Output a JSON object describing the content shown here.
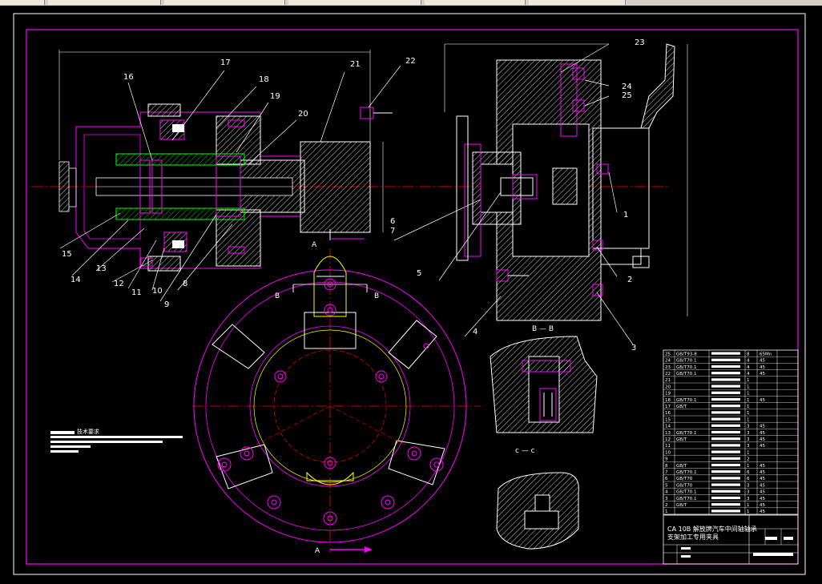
{
  "balloons": {
    "n16": "16",
    "n17": "17",
    "n18": "18",
    "n19": "19",
    "n20": "20",
    "n21": "21",
    "n22": "22",
    "n6": "6",
    "n7": "7",
    "n15": "15",
    "n14": "14",
    "n13": "13",
    "n12": "12",
    "n11": "11",
    "n10": "10",
    "n9": "9",
    "n8": "8",
    "n5": "5",
    "n23": "23",
    "n24": "24",
    "n25": "25",
    "n1": "1",
    "n2": "2",
    "n3": "3",
    "n4": "4"
  },
  "section_labels": {
    "a_top": "A",
    "a_bottom": "A",
    "b_left": "B",
    "b_right": "B",
    "bb": "B — B",
    "cc": "c — c"
  },
  "notes": {
    "title": "技术要求"
  },
  "title_block": {
    "line1": "CA 10B 解放牌汽车中间轴轴承",
    "line2": "支架加工专用夹具"
  },
  "bom_rows": [
    {
      "no": "25",
      "code": "GB/T93-8",
      "qty": "8",
      "mat": "65Mn"
    },
    {
      "no": "24",
      "code": "GB/T70.1",
      "qty": "4",
      "mat": "45"
    },
    {
      "no": "23",
      "code": "GB/T70.1",
      "qty": "4",
      "mat": "45"
    },
    {
      "no": "22",
      "code": "GB/T70.1",
      "qty": "4",
      "mat": "45"
    },
    {
      "no": "21",
      "code": "",
      "qty": "1",
      "mat": ""
    },
    {
      "no": "20",
      "code": "",
      "qty": "1",
      "mat": ""
    },
    {
      "no": "19",
      "code": "",
      "qty": "1",
      "mat": ""
    },
    {
      "no": "18",
      "code": "GB/T70.1",
      "qty": "1",
      "mat": "45"
    },
    {
      "no": "17",
      "code": "GB/T",
      "qty": "1",
      "mat": ""
    },
    {
      "no": "16",
      "code": "",
      "qty": "1",
      "mat": ""
    },
    {
      "no": "15",
      "code": "",
      "qty": "1",
      "mat": ""
    },
    {
      "no": "14",
      "code": "",
      "qty": "3",
      "mat": "45"
    },
    {
      "no": "13",
      "code": "GB/T70.1",
      "qty": "3",
      "mat": "45"
    },
    {
      "no": "12",
      "code": "GB/T",
      "qty": "3",
      "mat": "45"
    },
    {
      "no": "11",
      "code": "",
      "qty": "3",
      "mat": "45"
    },
    {
      "no": "10",
      "code": "",
      "qty": "1",
      "mat": ""
    },
    {
      "no": "9",
      "code": "",
      "qty": "2",
      "mat": ""
    },
    {
      "no": "8",
      "code": "GB/T",
      "qty": "1",
      "mat": "45"
    },
    {
      "no": "7",
      "code": "GB/T70.1",
      "qty": "6",
      "mat": "45"
    },
    {
      "no": "6",
      "code": "GB/T70",
      "qty": "6",
      "mat": "45"
    },
    {
      "no": "5",
      "code": "GB/T70",
      "qty": "3",
      "mat": "45"
    },
    {
      "no": "4",
      "code": "GB/T70.1",
      "qty": "3",
      "mat": "45"
    },
    {
      "no": "3",
      "code": "GB/T70.1",
      "qty": "3",
      "mat": "45"
    },
    {
      "no": "2",
      "code": "GB/T",
      "qty": "1",
      "mat": "45"
    },
    {
      "no": "1",
      "code": "",
      "qty": "1",
      "mat": "45"
    }
  ],
  "colors": {
    "frame": "#ff00ff",
    "outline": "#ffffff",
    "center": "#ff0000",
    "cyan": "#00ffff",
    "green": "#00ff00",
    "yellow": "#ffff00",
    "hatch": "#ffffff"
  }
}
